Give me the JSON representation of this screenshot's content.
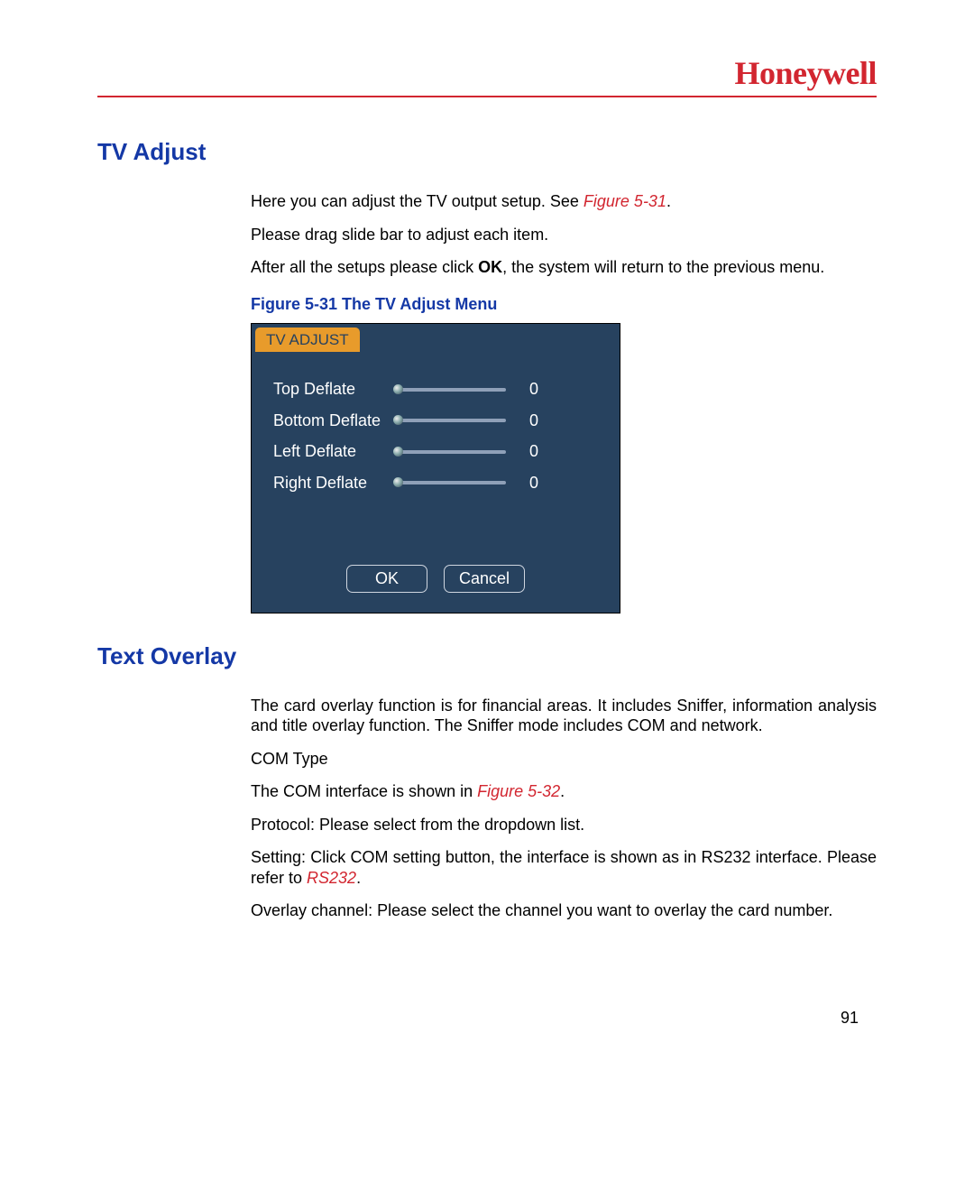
{
  "header": {
    "brand": "Honeywell"
  },
  "sections": {
    "tv_adjust": {
      "heading": "TV Adjust",
      "p1_a": "Here you can adjust the TV output setup. See ",
      "p1_ref": "Figure 5-31",
      "p1_b": ".",
      "p2": "Please drag slide bar to adjust each item.",
      "p3_a": "After all the setups please click ",
      "p3_bold": "OK",
      "p3_b": ", the system will return to the previous menu.",
      "figure_caption": "Figure 5-31 The TV Adjust Menu"
    },
    "text_overlay": {
      "heading": "Text Overlay",
      "p1": "The card overlay function is for financial areas. It includes Sniffer, information analysis and title overlay function. The Sniffer mode includes COM and network.",
      "p2": "COM Type",
      "p3_a": "The COM interface is shown in ",
      "p3_ref": "Figure 5-32",
      "p3_b": ".",
      "p4": "Protocol: Please select from the dropdown list.",
      "p5_a": "Setting: Click COM setting button, the interface is shown as in RS232 interface. Please refer to ",
      "p5_ref": "RS232",
      "p5_b": ".",
      "p6": "Overlay channel: Please select the channel you want to overlay the card number."
    }
  },
  "menu": {
    "tab": "TV ADJUST",
    "sliders": [
      {
        "label": "Top Deflate",
        "value": "0"
      },
      {
        "label": "Bottom Deflate",
        "value": "0"
      },
      {
        "label": "Left Deflate",
        "value": "0"
      },
      {
        "label": "Right Deflate",
        "value": "0"
      }
    ],
    "ok": "OK",
    "cancel": "Cancel"
  },
  "page_number": "91"
}
